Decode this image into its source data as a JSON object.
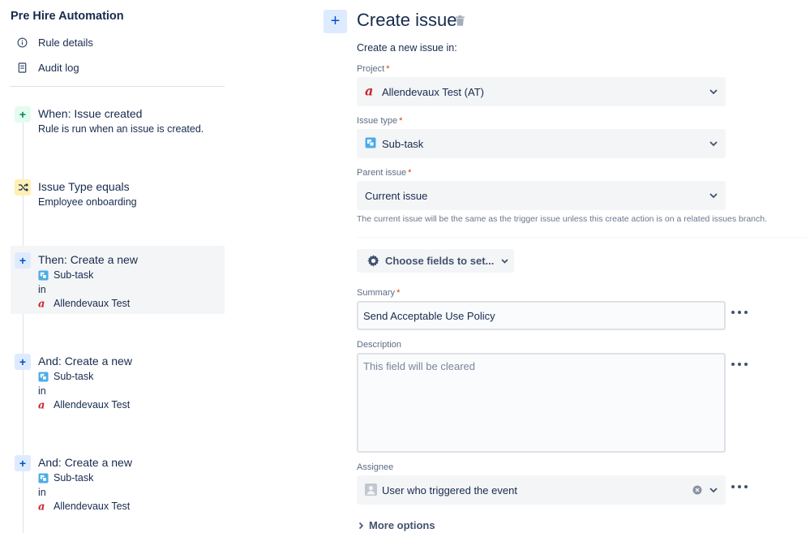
{
  "sidebar": {
    "rule_name": "Pre Hire Automation",
    "nav": [
      {
        "label": "Rule details",
        "icon": "info-icon"
      },
      {
        "label": "Audit log",
        "icon": "document-icon"
      }
    ],
    "components": [
      {
        "kind": "trigger",
        "icon": "plus-icon",
        "title": "When: Issue created",
        "subtitle": "Rule is run when an issue is created."
      },
      {
        "kind": "condition",
        "icon": "shuffle-icon",
        "title": "Issue Type equals",
        "subtitle": "Employee onboarding"
      },
      {
        "kind": "action",
        "icon": "plus-icon",
        "title": "Then: Create a new",
        "issue_type": "Sub-task",
        "in_label": "in",
        "project": "Allendevaux Test",
        "selected": true
      },
      {
        "kind": "action",
        "icon": "plus-icon",
        "title": "And: Create a new",
        "issue_type": "Sub-task",
        "in_label": "in",
        "project": "Allendevaux Test"
      },
      {
        "kind": "action",
        "icon": "plus-icon",
        "title": "And: Create a new",
        "issue_type": "Sub-task",
        "in_label": "in",
        "project": "Allendevaux Test"
      }
    ]
  },
  "panel": {
    "title": "Create issue",
    "intro": "Create a new issue in:",
    "project": {
      "label": "Project",
      "required": "*",
      "value": "Allendevaux Test (AT)",
      "icon": "project-a-icon"
    },
    "issue_type": {
      "label": "Issue type",
      "required": "*",
      "value": "Sub-task",
      "icon": "subtask-icon"
    },
    "parent_issue": {
      "label": "Parent issue",
      "required": "*",
      "value": "Current issue",
      "helper": "The current issue will be the same as the trigger issue unless this create action is on a related issues branch."
    },
    "choose_fields_label": "Choose fields to set...",
    "summary": {
      "label": "Summary",
      "required": "*",
      "value": "Send Acceptable Use Policy"
    },
    "description": {
      "label": "Description",
      "placeholder": "This field will be cleared"
    },
    "assignee": {
      "label": "Assignee",
      "value": "User who triggered the event",
      "icon": "user-avatar-icon"
    },
    "more_options": "More options"
  },
  "colors": {
    "accent": "#0052cc",
    "trigger_bg": "#e3fcef",
    "trigger_fg": "#00875a",
    "condition_bg": "#fff0b3",
    "action_bg": "#deebff",
    "project_icon": "#c9252c",
    "subtask_icon": "#4bade8",
    "required": "#de350b"
  }
}
